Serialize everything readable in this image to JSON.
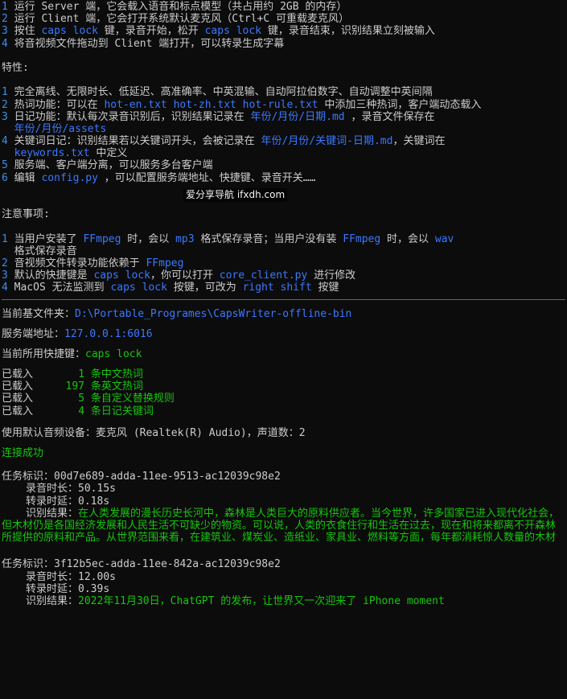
{
  "usage": [
    {
      "n": "1",
      "text": "运行 Server 端，它会载入语音和标点模型（共占用约 2GB 的内存）"
    },
    {
      "n": "2",
      "text": "运行 Client 端，它会打开系统默认麦克风（Ctrl+C 可重载麦克风）"
    },
    {
      "n": "3",
      "a": "按住 ",
      "k1": "caps lock",
      "b": " 键，录音开始，松开 ",
      "k2": "caps lock",
      "c": " 键，录音结束，识别结果立刻被输入"
    },
    {
      "n": "4",
      "text": "将音视频文件拖动到 Client 端打开，可以转录生成字幕"
    }
  ],
  "features_title": "特性:",
  "features": [
    {
      "n": "1",
      "text": "完全离线、无限时长、低延迟、高准确率、中英混输、自动阿拉伯数字、自动调整中英间隔"
    },
    {
      "n": "2",
      "a": "热词功能：可以在 ",
      "k": "hot-en.txt hot-zh.txt hot-rule.txt",
      "b": " 中添加三种热词，客户端动态载入"
    },
    {
      "n": "3",
      "a": "日记功能：默认每次录音识别后，识别结果记录在 ",
      "k": "年份/月份/日期.md",
      "b": " ，录音文件保存在",
      "cont": "年份/月份/assets"
    },
    {
      "n": "4",
      "a": "关键词日记：识别结果若以关键词开头，会被记录在 ",
      "k": "年份/月份/关键词-日期.md",
      "b": "，关键词在",
      "cont_k": "keywords.txt",
      "cont_b": " 中定义"
    },
    {
      "n": "5",
      "text": "服务端、客户端分离，可以服务多台客户端"
    },
    {
      "n": "6",
      "a": "编辑 ",
      "k": "config.py",
      "b": " ，可以配置服务端地址、快捷键、录音开关……"
    }
  ],
  "watermark": "爱分享导航 ifxdh.com",
  "notes_title": "注意事项:",
  "notes": [
    {
      "n": "1",
      "a": "当用户安装了 ",
      "k1": "FFmpeg",
      "b": " 时，会以 ",
      "k2": "mp3",
      "c": " 格式保存录音；当用户没有装 ",
      "k3": "FFmpeg",
      "d": " 时，会以 ",
      "k4": "wav",
      "cont": "格式保存录音"
    },
    {
      "n": "2",
      "a": "音视频文件转录功能依赖于 ",
      "k": "FFmpeg"
    },
    {
      "n": "3",
      "a": "默认的快捷键是 ",
      "k1": "caps lock",
      "b": "，你可以打开 ",
      "k2": "core_client.py",
      "c": " 进行修改"
    },
    {
      "n": "4",
      "a": "MacOS 无法监测到 ",
      "k1": "caps lock",
      "b": " 按键，可改为 ",
      "k2": "right shift",
      "c": " 按键"
    }
  ],
  "folder_label": "当前基文件夹：",
  "folder_value": "D:\\Portable_Programes\\CapsWriter-offline-bin",
  "server_label": "服务端地址：",
  "server_value": "127.0.0.1:6016",
  "hotkey_label": "当前所用快捷键：",
  "hotkey_value": "caps lock",
  "loaded": [
    {
      "label": "已载入",
      "count": "1",
      "text": "条中文热词"
    },
    {
      "label": "已载入",
      "count": "197",
      "text": "条英文热词"
    },
    {
      "label": "已载入",
      "count": "5",
      "text": "条自定义替换规则"
    },
    {
      "label": "已载入",
      "count": "4",
      "text": "条日记关键词"
    }
  ],
  "audio_device": "使用默认音频设备：麦克风 (Realtek(R) Audio)，声道数：2",
  "connected": "连接成功",
  "task1": {
    "id_label": "任务标识：",
    "id": "00d7e689-adda-11ee-9513-ac12039c98e2",
    "dur_label": "录音时长：",
    "dur": "50.15s",
    "delay_label": "转录时延：",
    "delay": "0.18s",
    "result_label": "识别结果：",
    "result": "在人类发展的漫长历史长河中，森林是人类巨大的原料供应者。当今世界，许多国家已进入现代化社会，但木材仍是各国经济发展和人民生活不可缺少的物资。可以说，人类的衣食住行和生活在过去，现在和将来都离不开森林所提供的原料和产品。从世界范围来看，在建筑业、煤炭业、造纸业、家具业、燃料等方面，每年都消耗惊人数量的木材"
  },
  "task2": {
    "id_label": "任务标识：",
    "id": "3f12b5ec-adda-11ee-842a-ac12039c98e2",
    "dur_label": "录音时长：",
    "dur": "12.00s",
    "delay_label": "转录时延：",
    "delay": "0.39s",
    "result_label": "识别结果：",
    "result": "2022年11月30日，ChatGPT 的发布，让世界又一次迎来了 iPhone moment"
  }
}
